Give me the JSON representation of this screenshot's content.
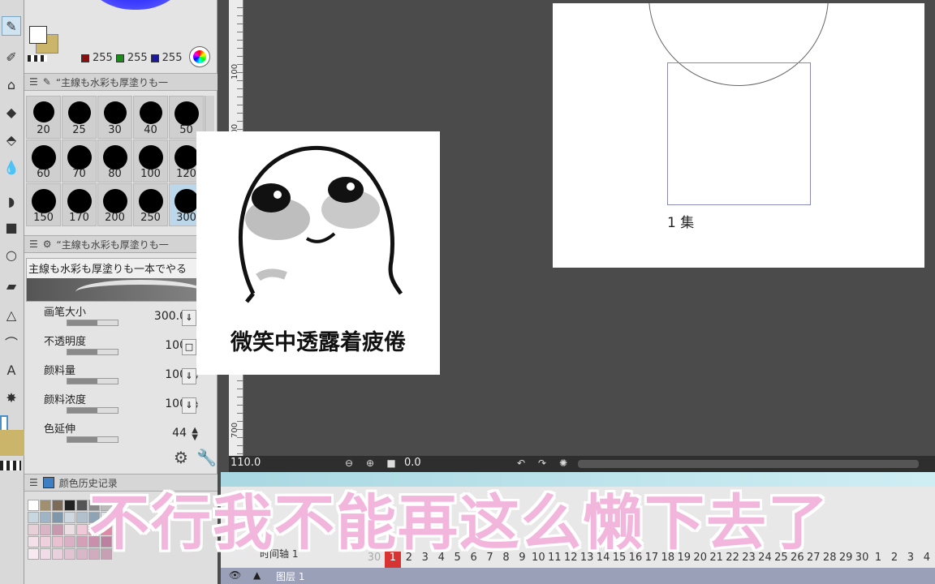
{
  "color": {
    "rgb": {
      "r": "255",
      "g": "255",
      "b": "255"
    },
    "main_swatch": "#ffffff",
    "sub_swatch": "#cbb56a"
  },
  "brush_panel": {
    "header": "“主線も水彩も厚塗りも一",
    "sizes": [
      "20",
      "25",
      "30",
      "40",
      "50",
      "60",
      "70",
      "80",
      "100",
      "120",
      "150",
      "170",
      "200",
      "250",
      "300"
    ],
    "selected": "300"
  },
  "tool_property": {
    "header": "“主線も水彩も厚塗りも一",
    "preview_text": "主線も水彩も厚塗りも一本でやる",
    "props": [
      {
        "label": "画笔大小",
        "value": "300.0"
      },
      {
        "label": "不透明度",
        "value": "100"
      },
      {
        "label": "颜料量",
        "value": "100"
      },
      {
        "label": "颜料浓度",
        "value": "100"
      },
      {
        "label": "色延伸",
        "value": "44"
      }
    ]
  },
  "palette_panel": {
    "header": "颜色历史记录"
  },
  "ruler": {
    "labels": [
      "100",
      "200",
      "700"
    ]
  },
  "canvas": {
    "label": "1 集"
  },
  "meme": {
    "caption": "微笑中透露着疲倦"
  },
  "statusbar": {
    "zoom": "110.0",
    "rotation": "0.0"
  },
  "timeline": {
    "track_name": "时间轴 1",
    "frame_prefix": "30",
    "frames": [
      "1",
      "2",
      "3",
      "4",
      "5",
      "6",
      "7",
      "8",
      "9",
      "10",
      "11",
      "12",
      "13",
      "14",
      "15",
      "16",
      "17",
      "18",
      "19",
      "20",
      "21",
      "22",
      "23",
      "24",
      "25",
      "26",
      "27",
      "28",
      "29",
      "30",
      "1",
      "2",
      "3",
      "4"
    ],
    "layer": "图层 1"
  },
  "subtitle": "不行我不能再这么懒下去了"
}
